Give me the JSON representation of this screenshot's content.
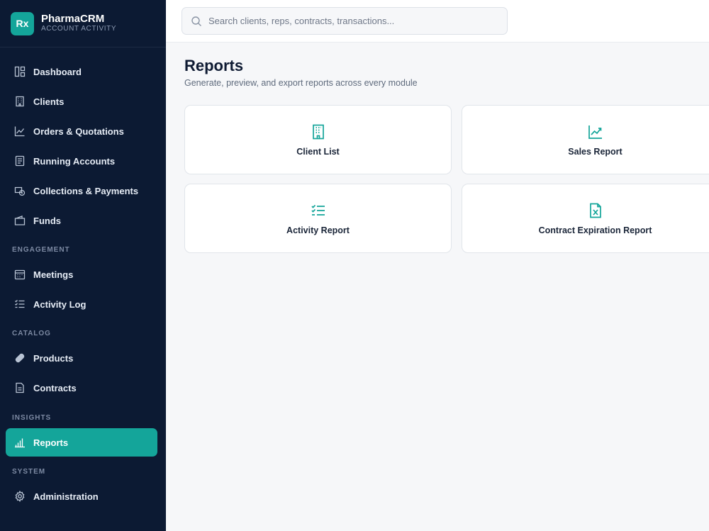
{
  "brand": {
    "logo": "Rx",
    "name": "PharmaCRM",
    "subtitle": "ACCOUNT ACTIVITY"
  },
  "sidebar": {
    "items": [
      {
        "label": "Dashboard",
        "icon": "dashboard-icon"
      },
      {
        "label": "Clients",
        "icon": "building-icon"
      },
      {
        "label": "Orders & Quotations",
        "icon": "chart-line-icon"
      },
      {
        "label": "Running Accounts",
        "icon": "ledger-icon"
      },
      {
        "label": "Collections & Payments",
        "icon": "payments-icon"
      },
      {
        "label": "Funds",
        "icon": "wallet-icon"
      },
      {
        "label": "Meetings",
        "icon": "calendar-icon"
      },
      {
        "label": "Activity Log",
        "icon": "list-check-icon"
      },
      {
        "label": "Products",
        "icon": "pill-icon"
      },
      {
        "label": "Contracts",
        "icon": "document-icon"
      },
      {
        "label": "Reports",
        "icon": "bar-chart-icon",
        "active": true
      },
      {
        "label": "Administration",
        "icon": "gear-icon"
      }
    ],
    "sections": [
      "ENGAGEMENT",
      "CATALOG",
      "INSIGHTS",
      "SYSTEM"
    ]
  },
  "search": {
    "placeholder": "Search clients, reps, contracts, transactions..."
  },
  "page": {
    "title": "Reports",
    "subtitle": "Generate, preview, and export reports across every module"
  },
  "cards": [
    {
      "label": "Client List",
      "icon": "building-icon"
    },
    {
      "label": "Sales Report",
      "icon": "chart-line-icon"
    },
    {
      "label": "Activity Report",
      "icon": "list-check-icon"
    },
    {
      "label": "Contract Expiration Report",
      "icon": "excel-file-icon"
    }
  ],
  "colors": {
    "sidebar_bg": "#0c1a33",
    "accent": "#14a59a",
    "page_bg": "#f6f7f9"
  }
}
